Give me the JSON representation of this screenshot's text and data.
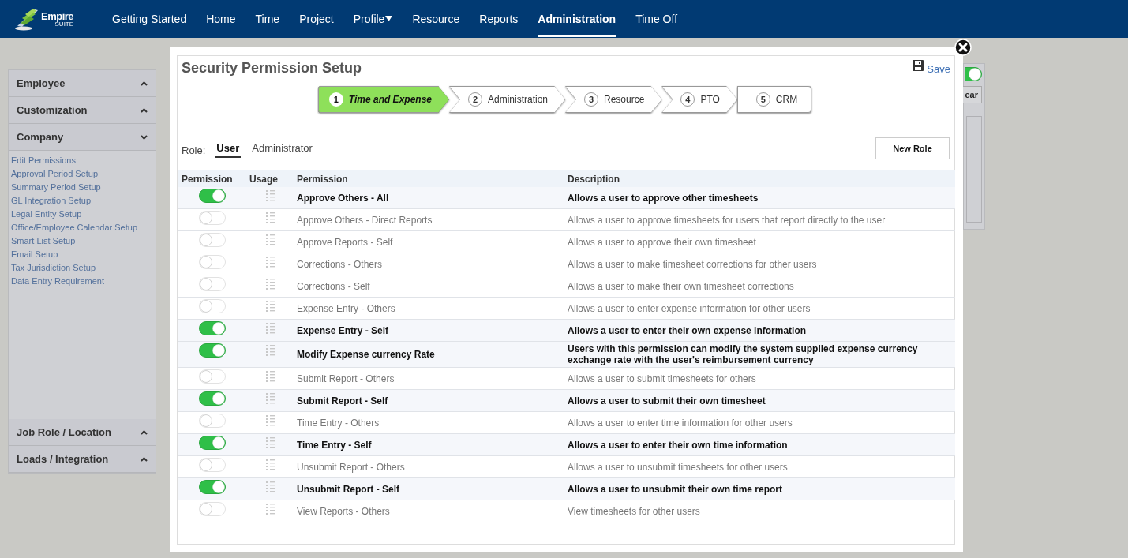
{
  "logo": {
    "name": "Empire",
    "subtitle": "SUITE"
  },
  "nav": [
    {
      "label": "Getting Started",
      "selected": false,
      "dropdown": false
    },
    {
      "label": "Home",
      "selected": false,
      "dropdown": false
    },
    {
      "label": "Time",
      "selected": false,
      "dropdown": false
    },
    {
      "label": "Project",
      "selected": false,
      "dropdown": false
    },
    {
      "label": "Profile",
      "selected": false,
      "dropdown": true
    },
    {
      "label": "Resource",
      "selected": false,
      "dropdown": false
    },
    {
      "label": "Reports",
      "selected": false,
      "dropdown": false
    },
    {
      "label": "Administration",
      "selected": true,
      "dropdown": false
    },
    {
      "label": "Time Off",
      "selected": false,
      "dropdown": false
    }
  ],
  "sidebar": {
    "sections": [
      {
        "title": "Employee",
        "expanded": false
      },
      {
        "title": "Customization",
        "expanded": false
      },
      {
        "title": "Company",
        "expanded": true,
        "links": [
          "Edit Permissions",
          "Approval Period Setup",
          "Summary Period Setup",
          "GL Integration Setup",
          "Legal Entity Setup",
          "Office/Employee Calendar Setup",
          "Smart List Setup",
          "Email Setup",
          "Tax Jurisdiction Setup",
          "Data Entry Requirement"
        ]
      },
      {
        "title": "Job Role / Location",
        "expanded": false
      },
      {
        "title": "Loads / Integration",
        "expanded": false
      }
    ]
  },
  "background_panel": {
    "toggle_on": true,
    "button": "ear"
  },
  "modal": {
    "title": "Security Permission Setup",
    "save": "Save",
    "steps": [
      {
        "number": "1",
        "label": "Time and Expense",
        "selected": true
      },
      {
        "number": "2",
        "label": "Administration",
        "selected": false
      },
      {
        "number": "3",
        "label": "Resource",
        "selected": false
      },
      {
        "number": "4",
        "label": "PTO",
        "selected": false
      },
      {
        "number": "5",
        "label": "CRM",
        "selected": false
      }
    ],
    "role_label": "Role:",
    "roles": [
      {
        "label": "User",
        "selected": true
      },
      {
        "label": "Administrator",
        "selected": false
      }
    ],
    "new_role": "New Role",
    "columns": [
      "Permission",
      "Usage",
      "Permission",
      "Description"
    ],
    "rows": [
      {
        "on": true,
        "permission": "Approve Others - All",
        "description": "Allows a user to approve other timesheets"
      },
      {
        "on": false,
        "permission": "Approve Others - Direct Reports",
        "description": "Allows a user to approve timesheets for users that report directly to the user"
      },
      {
        "on": false,
        "permission": "Approve Reports - Self",
        "description": "Allows a user to approve their own timesheet"
      },
      {
        "on": false,
        "permission": "Corrections - Others",
        "description": "Allows a user to make timesheet corrections for other users"
      },
      {
        "on": false,
        "permission": "Corrections - Self",
        "description": "Allows a user to make their own timesheet corrections"
      },
      {
        "on": false,
        "permission": "Expense Entry - Others",
        "description": "Allows a user to enter expense information for other users"
      },
      {
        "on": true,
        "permission": "Expense Entry - Self",
        "description": "Allows a user to enter their own expense information"
      },
      {
        "on": true,
        "permission": "Modify Expense currency Rate",
        "description": "Users with this permission can modify the system supplied expense currency exchange rate with the user's reimbursement currency"
      },
      {
        "on": false,
        "permission": "Submit Report - Others",
        "description": "Allows a user to submit timesheets for others"
      },
      {
        "on": true,
        "permission": "Submit Report - Self",
        "description": "Allows a user to submit their own timesheet"
      },
      {
        "on": false,
        "permission": "Time Entry - Others",
        "description": "Allows a user to enter time information for other users"
      },
      {
        "on": true,
        "permission": "Time Entry - Self",
        "description": "Allows a user to enter their own time information"
      },
      {
        "on": false,
        "permission": "Unsubmit Report - Others",
        "description": "Allows a user to unsubmit timesheets for other users"
      },
      {
        "on": true,
        "permission": "Unsubmit Report - Self",
        "description": "Allows a user to unsubmit their own time report"
      },
      {
        "on": false,
        "permission": "View Reports - Others",
        "description": "View timesheets for other users"
      }
    ]
  }
}
